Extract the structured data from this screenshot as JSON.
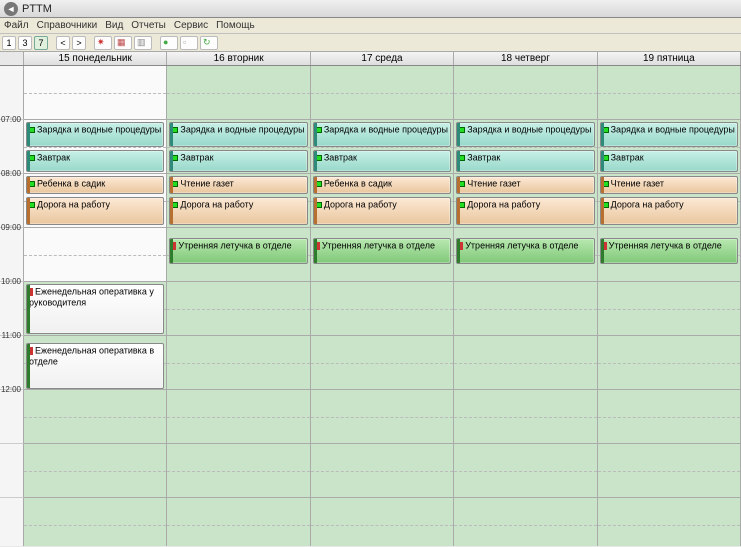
{
  "window": {
    "title": "PTTM"
  },
  "menu": [
    "Файл",
    "Справочники",
    "Вид",
    "Отчеты",
    "Сервис",
    "Помощь"
  ],
  "toolbar_nums": [
    "1",
    "3",
    "7"
  ],
  "days": [
    {
      "label": "15 понедельник",
      "offwork": true
    },
    {
      "label": "16 вторник",
      "offwork": false
    },
    {
      "label": "17 среда",
      "offwork": false
    },
    {
      "label": "18 четверг",
      "offwork": false
    },
    {
      "label": "19 пятница",
      "offwork": false
    }
  ],
  "hours": [
    "07:00",
    "08:00",
    "09:00",
    "10:00",
    "11:00",
    "12:00"
  ],
  "events": {
    "zarjadka": "Зарядка и водные процедуры",
    "zavtrak": "Завтрак",
    "rebenka": "Ребенка в садик",
    "gazet": "Чтение газет",
    "doroga": "Дорога на работу",
    "letuchka": "Утренняя летучка в отделе",
    "oper_ruk": "Еженедельная оперативка у руководителя",
    "oper_otd": "Еженедельная оперативка в отделе"
  },
  "chart_data": {
    "type": "table",
    "title": "Weekly calendar (work week view)",
    "columns": [
      "15 понедельник",
      "16 вторник",
      "17 среда",
      "18 четверг",
      "19 пятница"
    ],
    "rows": [
      {
        "time": "07:00-07:30",
        "cells": [
          "Зарядка и водные процедуры",
          "Зарядка и водные процедуры",
          "Зарядка и водные процедуры",
          "Зарядка и водные процедуры",
          "Зарядка и водные процедуры"
        ]
      },
      {
        "time": "07:30-08:00",
        "cells": [
          "Завтрак",
          "Завтрак",
          "Завтрак",
          "Завтрак",
          "Завтрак"
        ]
      },
      {
        "time": "08:00-08:20",
        "cells": [
          "Ребенка в садик",
          "Чтение газет",
          "Ребенка в садик",
          "Чтение газет",
          "Чтение газет"
        ]
      },
      {
        "time": "08:20-09:00",
        "cells": [
          "Дорога на работу",
          "Дорога на работу",
          "Дорога на работу",
          "Дорога на работу",
          "Дорога на работу"
        ]
      },
      {
        "time": "09:10-09:40",
        "cells": [
          "",
          "Утренняя летучка в отделе",
          "Утренняя летучка в отделе",
          "Утренняя летучка в отделе",
          "Утренняя летучка в отделе"
        ]
      },
      {
        "time": "10:00-11:00",
        "cells": [
          "Еженедельная оперативка у руководителя",
          "",
          "",
          "",
          ""
        ]
      },
      {
        "time": "11:10-12:00",
        "cells": [
          "Еженедельная оперативка в отделе",
          "",
          "",
          "",
          ""
        ]
      }
    ]
  }
}
